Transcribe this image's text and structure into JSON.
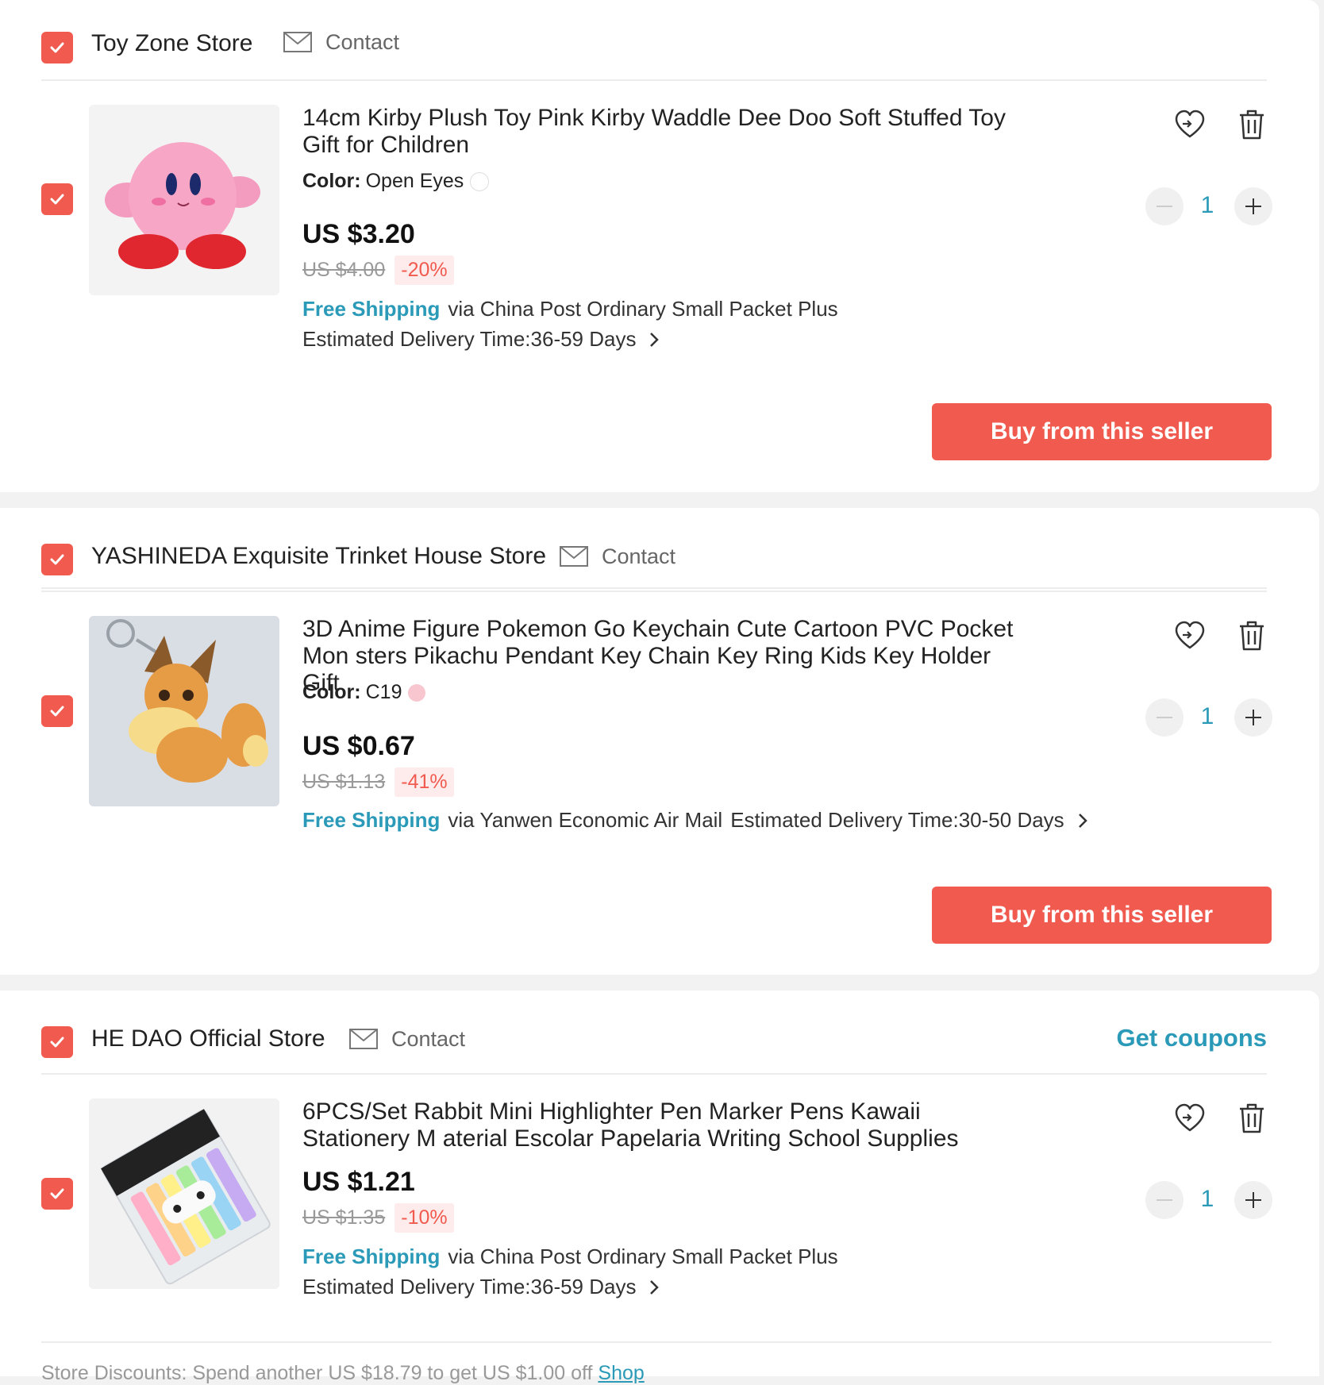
{
  "colors": {
    "accent": "#f15a4f",
    "link": "#2a9ab8"
  },
  "common": {
    "contact_label": "Contact",
    "buy_label": "Buy from this seller",
    "free_shipping": "Free Shipping",
    "color_label": "Color:",
    "icons": {
      "wishlist": "heart-icon",
      "delete": "trash-icon",
      "mail": "mail-icon",
      "chevron": "chevron-right-icon",
      "check": "checkmark-icon"
    }
  },
  "stores": [
    {
      "name": "Toy Zone Store",
      "selected": true,
      "item": {
        "selected": true,
        "title": "14cm Kirby Plush Toy Pink Kirby Waddle Dee Doo Soft Stuffed Toy Gift for Children",
        "color_value": "Open Eyes",
        "swatch": "#ffffff",
        "price": "US $3.20",
        "old_price": "US $4.00",
        "discount": "-20%",
        "shipping_via": "via China Post Ordinary Small Packet Plus",
        "delivery": "Estimated Delivery Time:36-59 Days",
        "quantity": "1"
      }
    },
    {
      "name": "YASHINEDA Exquisite Trinket House Store",
      "selected": true,
      "item": {
        "selected": true,
        "title": "3D Anime Figure Pokemon Go Keychain Cute Cartoon PVC Pocket Mon sters Pikachu Pendant Key Chain Key Ring Kids Key Holder Gift",
        "color_value": "C19",
        "swatch": "#f7c6cf",
        "price": "US $0.67",
        "old_price": "US $1.13",
        "discount": "-41%",
        "shipping_via": "via Yanwen Economic Air Mail",
        "delivery": "Estimated Delivery Time:30-50 Days",
        "quantity": "1"
      }
    },
    {
      "name": "HE DAO Official Store",
      "selected": true,
      "coupons_label": "Get coupons",
      "item": {
        "selected": true,
        "title": "6PCS/Set Rabbit Mini Highlighter Pen Marker Pens Kawaii Stationery M aterial Escolar Papelaria Writing School Supplies",
        "price": "US $1.21",
        "old_price": "US $1.35",
        "discount": "-10%",
        "shipping_via": "via China Post Ordinary Small Packet Plus",
        "delivery": "Estimated Delivery Time:36-59 Days",
        "quantity": "1"
      },
      "store_discount_text": "Store Discounts: Spend another US $18.79 to get US $1.00 off",
      "store_discount_link": "Shop"
    }
  ]
}
